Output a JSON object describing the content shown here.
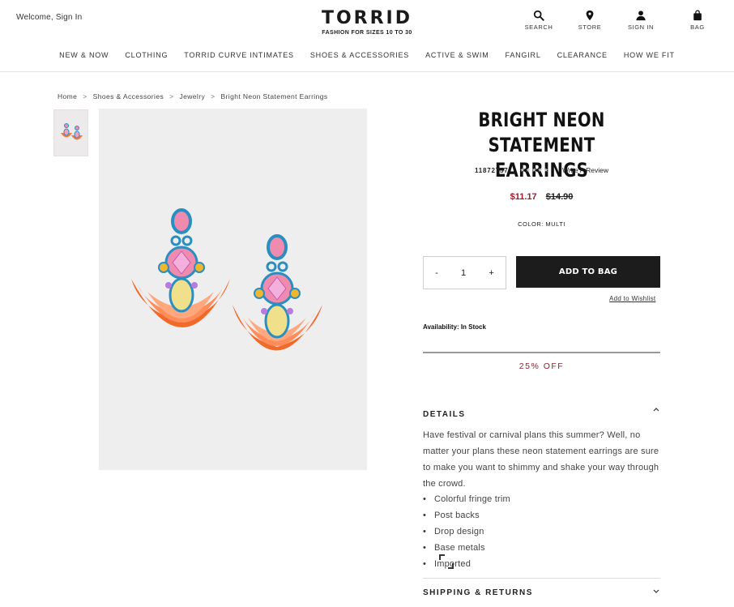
{
  "header": {
    "welcome": "Welcome, Sign In",
    "logo": "TORRID",
    "tagline": "FASHION FOR SIZES 10 TO 30",
    "utility": {
      "search": "SEARCH",
      "store": "STORE",
      "sign_in": "SIGN IN",
      "bag": "BAG"
    }
  },
  "nav": {
    "items": [
      "NEW & NOW",
      "CLOTHING",
      "TORRID CURVE INTIMATES",
      "SHOES & ACCESSORIES",
      "ACTIVE & SWIM",
      "FANGIRL",
      "CLEARANCE",
      "HOW WE FIT"
    ]
  },
  "breadcrumb": {
    "items": [
      "Home",
      "Shoes & Accessories",
      "Jewelry",
      "Bright Neon Statement Earrings"
    ],
    "separator": ">"
  },
  "product": {
    "title": "BRIGHT NEON STATEMENT EARRINGS",
    "sku": "11872757",
    "meta_separator": "|",
    "rating_stars": "★★★★★",
    "write_review": "Write A Review",
    "sale_price": "$11.17",
    "original_price": "$14.90",
    "color_label": "COLOR: MULTI",
    "quantity": {
      "minus": "-",
      "value": "1",
      "plus": "+"
    },
    "add_to_bag": "ADD TO BAG",
    "add_to_wishlist": "Add to Wishlist",
    "availability": "Availability: In Stock",
    "promo": "25% OFF",
    "details": {
      "heading": "DETAILS",
      "description": "Have festival or carnival plans this summer? Well, no matter your plans these neon statement earrings are sure to make you want to shimmy and shake your way through the crowd.",
      "bullets": [
        "Colorful fringe trim",
        "Post backs",
        "Drop design",
        "Base metals",
        "Imported"
      ]
    },
    "shipping_heading": "SHIPPING & RETURNS"
  },
  "colors": {
    "sale_red": "#a3192b",
    "promo_red": "#8e2230",
    "button_dark": "#1c1c1c"
  }
}
